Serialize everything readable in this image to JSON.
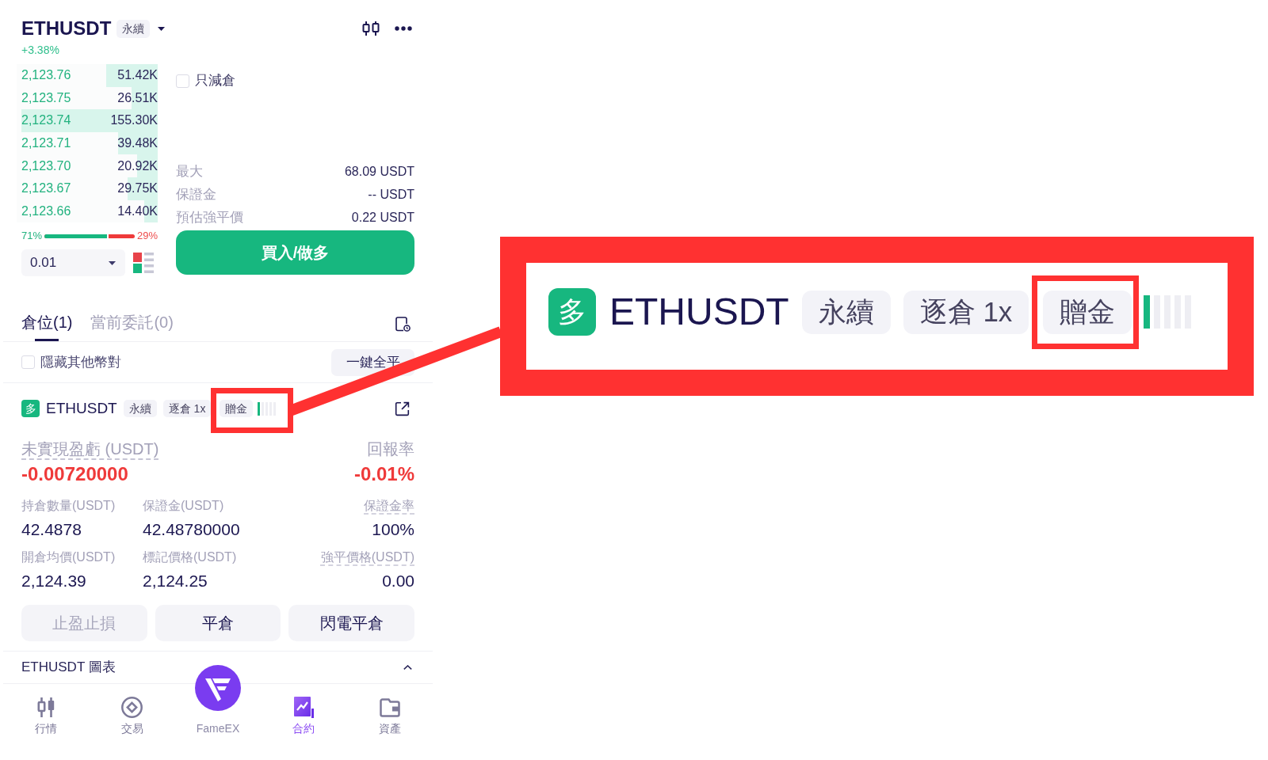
{
  "header": {
    "symbol": "ETHUSDT",
    "contract_type": "永續",
    "change": "+3.38%"
  },
  "order_book": {
    "rows": [
      {
        "price": "2,123.76",
        "amount": "51.42K",
        "level": 0.38
      },
      {
        "price": "2,123.75",
        "amount": "26.51K",
        "level": 0.19
      },
      {
        "price": "2,123.74",
        "amount": "155.30K",
        "level": 1
      },
      {
        "price": "2,123.71",
        "amount": "39.48K",
        "level": 0.29
      },
      {
        "price": "2,123.70",
        "amount": "20.92K",
        "level": 0.15
      },
      {
        "price": "2,123.67",
        "amount": "29.75K",
        "level": 0.22
      },
      {
        "price": "2,123.66",
        "amount": "14.40K",
        "level": 0.1
      }
    ],
    "ratio": {
      "buy": "71%",
      "sell": "29%",
      "level": 0.71
    },
    "precision": "0.01"
  },
  "order_form": {
    "reduce_only": {
      "label": "只減倉",
      "checked": false
    },
    "info": [
      {
        "label": "最大",
        "value": "68.09 USDT"
      },
      {
        "label": "保證金",
        "value": "-- USDT"
      },
      {
        "label": "預估強平價",
        "value": "0.22 USDT"
      }
    ],
    "submit_button": "買入/做多"
  },
  "positions": {
    "tabs": [
      {
        "label": "倉位(1)",
        "selected": true
      },
      {
        "label": "當前委託(0)",
        "selected": false
      }
    ],
    "hide_other_pairs": {
      "label": "隱藏其他幣對",
      "checked": false
    },
    "close_all_button": "一鍵全平",
    "card": {
      "side": "多",
      "symbol": "ETHUSDT",
      "tags": [
        {
          "label": "永續",
          "highlighted": false
        },
        {
          "label": "逐倉 1x",
          "highlighted": false
        },
        {
          "label": "贈金",
          "highlighted": true
        }
      ],
      "risk": {
        "level": 0.2
      },
      "pnl": {
        "label": "未實現盈虧 (USDT)",
        "value": "-0.00720000",
        "hint": true
      },
      "roe": {
        "label": "回報率",
        "value": "-0.01%",
        "hint": false
      },
      "stats": [
        {
          "label": "持倉數量(USDT)",
          "value": "42.4878",
          "hint": false
        },
        {
          "label": "保證金(USDT)",
          "value": "42.48780000",
          "hint": false
        },
        {
          "label": "保證金率",
          "value": "100%",
          "hint": true
        },
        {
          "label": "開倉均價(USDT)",
          "value": "2,124.39",
          "hint": false
        },
        {
          "label": "標記價格(USDT)",
          "value": "2,124.25",
          "hint": false
        },
        {
          "label": "強平價格(USDT)",
          "value": "0.00",
          "hint": true
        }
      ],
      "actions": [
        {
          "label": "止盈止損",
          "disabled": true
        },
        {
          "label": "平倉",
          "disabled": false
        },
        {
          "label": "閃電平倉",
          "disabled": false
        }
      ]
    },
    "chart_panel": {
      "label": "ETHUSDT 圖表"
    }
  },
  "bottom_nav": [
    {
      "label": "行情",
      "kind": "tab",
      "selected": false
    },
    {
      "label": "交易",
      "kind": "tab",
      "selected": false
    },
    {
      "label": "FameEX",
      "kind": "brand",
      "selected": false
    },
    {
      "label": "合約",
      "kind": "tab",
      "selected": true
    },
    {
      "label": "資產",
      "kind": "tab",
      "selected": false
    }
  ],
  "callout": {
    "side": "多",
    "symbol": "ETHUSDT",
    "tags": [
      {
        "label": "永續",
        "highlighted": false
      },
      {
        "label": "逐倉 1x",
        "highlighted": false
      },
      {
        "label": "贈金",
        "highlighted": true
      }
    ],
    "risk": {
      "level": 0.2
    }
  }
}
